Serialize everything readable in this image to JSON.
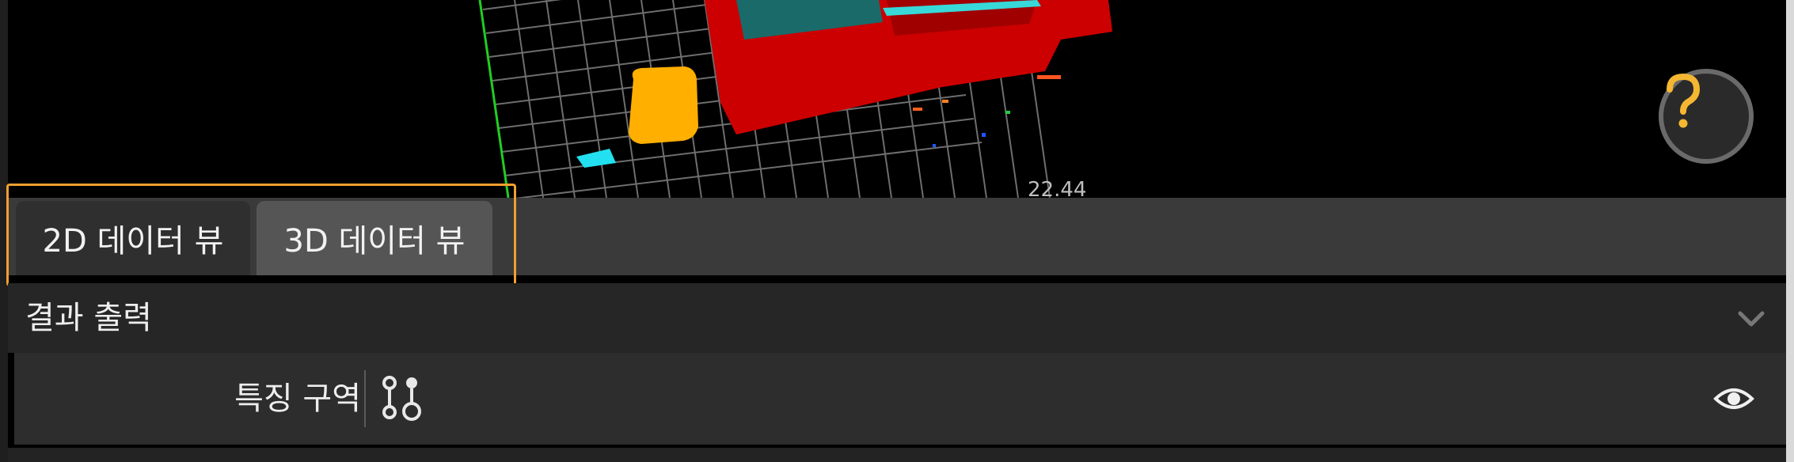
{
  "viewport": {
    "axis_label": "22.44"
  },
  "tabs": [
    {
      "label": "2D 데이터 뷰"
    },
    {
      "label": "3D 데이터 뷰"
    }
  ],
  "section": {
    "title": "결과 출력"
  },
  "row": {
    "label": "특징 구역"
  },
  "icons": {
    "help": "question-icon",
    "collapse": "chevron-down-icon",
    "feature": "feature-region-icon",
    "visibility": "eye-icon"
  },
  "colors": {
    "accent_highlight": "#f0a030",
    "help_mark": "#f5b731",
    "point_cloud_red": "#cc0000",
    "point_cloud_orange": "#ffb000",
    "point_cloud_cyan": "#22e0f0"
  }
}
